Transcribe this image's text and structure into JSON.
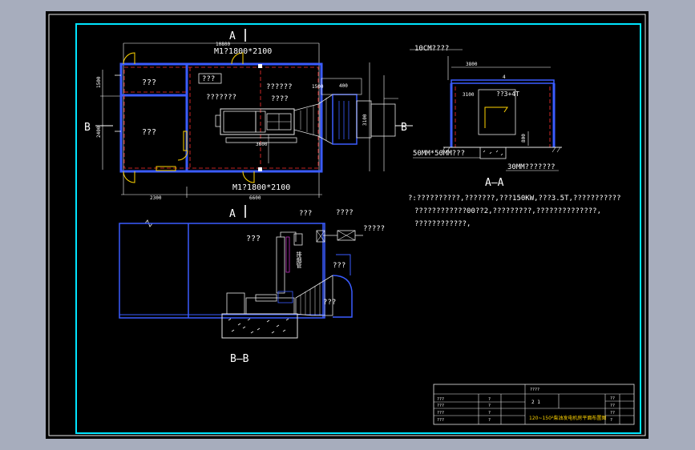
{
  "colors": {
    "background_outer": "#a7adbd",
    "drawing_background": "#000000",
    "frame": "#00e5ff",
    "walls": "#3a5cff",
    "axis": "#ff3030",
    "dims": "#ffffff",
    "equipment": "#e8e8e8",
    "accent": "#ffd400",
    "cable": "#ff40ff"
  },
  "plan": {
    "section_a_top": "A",
    "section_a_bottom": "A",
    "section_b_left": "B",
    "section_b_right": "B",
    "door_top": "M1?1800*2100",
    "door_bottom": "M1?1800*2100",
    "room_top_left": "???",
    "room_mid_left": "???",
    "boxed_label": "???",
    "label_1": "??????",
    "label_2": "????",
    "label_3": "???????",
    "dim_total": "10800",
    "dim_bottom_total": "6600",
    "dim_bottom_left": "2300",
    "dim_left_1": "1500",
    "dim_left_2": "2400",
    "dim_inner": "3600",
    "dim_right_1": "1500",
    "dim_right_2": "3100",
    "dim_right_3": "400"
  },
  "section_aa": {
    "title": "A—A",
    "label_top": "10CM????",
    "label_box": "??3+4T",
    "label_bottom_1": "50MM*50MM???",
    "label_bottom_2": "30MM???????",
    "dim_1": "3800",
    "dim_2": "4",
    "dim_3": "3100",
    "dim_4": "800"
  },
  "notes": {
    "line_1": "?:??????????,???????,???150KW,???3.5T,???????????",
    "line_2": "????????????00??2,?????????,??????????????,",
    "line_3": "????????????,"
  },
  "section_bb": {
    "title": "B—B",
    "label_top": "???",
    "label_1": "????",
    "label_2": "?????",
    "label_room": "???",
    "label_3": "???",
    "label_4": "???",
    "label_vertical": "排烟管"
  },
  "title_block": {
    "header_cell": "????",
    "cell_mid": "2  1",
    "project_title": "120~150²柴油发电机房平面布置图",
    "row_labels": [
      "???",
      "???",
      "???",
      "???"
    ],
    "col_values": [
      "?",
      "?",
      "?",
      "?"
    ],
    "right_values": [
      "??",
      "??",
      "??",
      "?"
    ]
  }
}
